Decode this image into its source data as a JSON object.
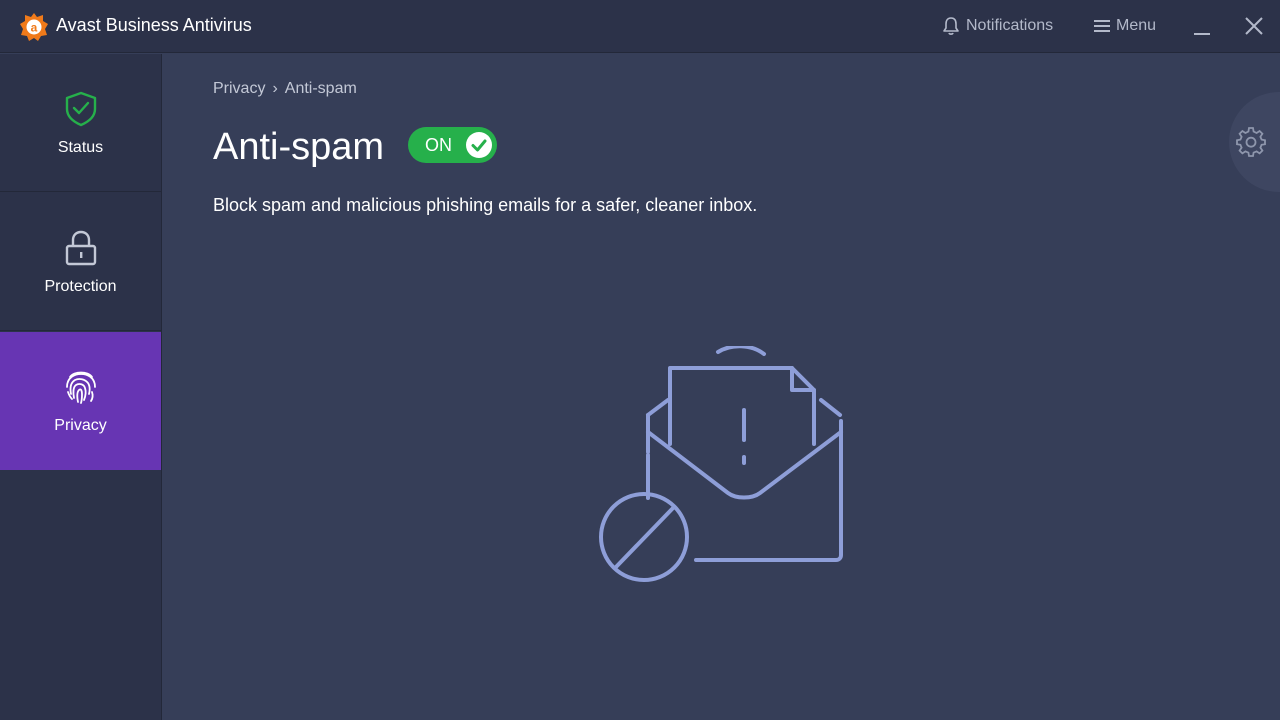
{
  "app": {
    "title": "Avast Business Antivirus",
    "accent_color": "#f07a1a"
  },
  "titlebar": {
    "notifications_label": "Notifications",
    "menu_label": "Menu"
  },
  "sidebar": {
    "items": [
      {
        "label": "Status",
        "icon": "shield-check-icon",
        "active": false
      },
      {
        "label": "Protection",
        "icon": "lock-icon",
        "active": false
      },
      {
        "label": "Privacy",
        "icon": "fingerprint-icon",
        "active": true
      }
    ],
    "active_color": "#6735b3"
  },
  "breadcrumb": {
    "parent": "Privacy",
    "separator": "›",
    "current": "Anti-spam"
  },
  "page": {
    "title": "Anti-spam",
    "toggle_label": "ON",
    "toggle_state": "on",
    "toggle_color": "#26b04b",
    "description": "Block spam and malicious phishing emails for a safer, cleaner inbox."
  },
  "illustration": {
    "icon": "spam-envelope-blocked-icon",
    "color": "#8e9ed8"
  }
}
